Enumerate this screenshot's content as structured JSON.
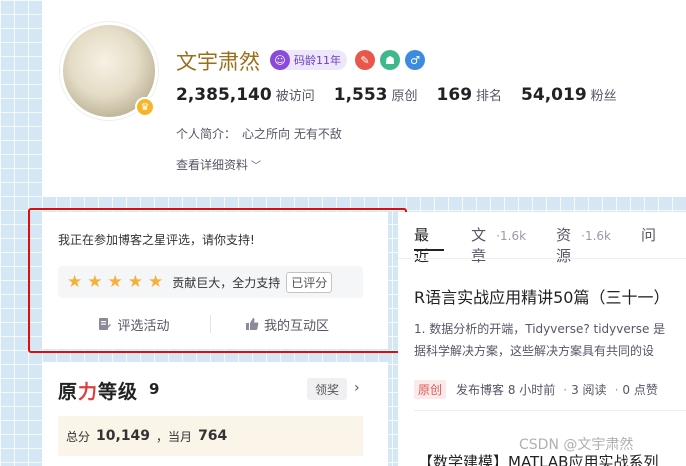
{
  "profile": {
    "username": "文宇肃然",
    "code_age": "码龄11年",
    "stats": [
      {
        "value": "2,385,140",
        "label": "被访问"
      },
      {
        "value": "1,553",
        "label": "原创"
      },
      {
        "value": "169",
        "label": "排名"
      },
      {
        "value": "54,019",
        "label": "粉丝"
      }
    ],
    "bio_label": "个人简介：",
    "bio_text": "心之所向 无有不敌",
    "details_link": "查看详细资料"
  },
  "vote": {
    "title": "我正在参加博客之星评选，请你支持!",
    "rating": 5,
    "rating_text": "贡献巨大，全力支持",
    "rated_tag": "已评分",
    "actions": [
      "评选活动",
      "我的互动区"
    ]
  },
  "level": {
    "logo_pre": "原",
    "logo_mid": "力",
    "logo_post": "等级",
    "number": "9",
    "award_button": "领奖",
    "total_label": "总分",
    "total_value": "10,149",
    "month_label": "，当月",
    "month_value": "764"
  },
  "content": {
    "tabs": [
      {
        "label": "最近",
        "count": ""
      },
      {
        "label": "文章",
        "count": "·1.6k"
      },
      {
        "label": "资源",
        "count": "·1.6k"
      },
      {
        "label": "问",
        "count": ""
      }
    ],
    "article": {
      "title": "R语言实战应用精讲50篇（三十一）",
      "desc_line1": "1. 数据分析的开端，Tidyverse? tidyverse 是",
      "desc_line2": "据科学解决方案，这些解决方案具有共同的设",
      "tag": "原创",
      "published": "发布博客 8 小时前",
      "reads": "3 阅读",
      "likes": "0 点赞"
    },
    "article2_title": "【数学建模】MATLAB应用实战系列"
  },
  "watermark": "CSDN @文宇肃然",
  "colors": {
    "highlight": "#e00b0b",
    "star": "#f6b13a",
    "username": "#9b6e1c",
    "code_age": "#8a4bdc"
  }
}
